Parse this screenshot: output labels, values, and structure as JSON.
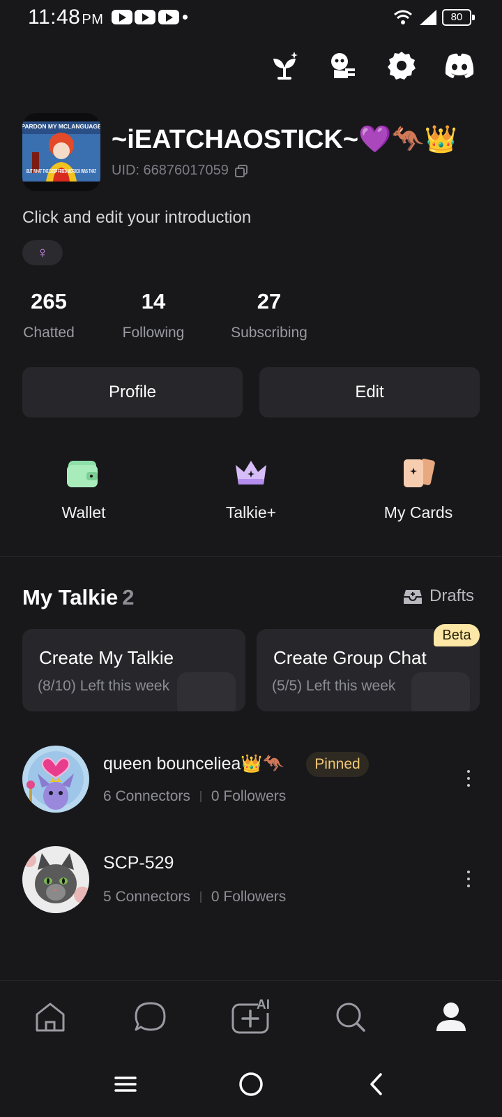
{
  "status_bar": {
    "time": "11:48",
    "ampm": "PM",
    "battery": "80"
  },
  "top_actions": [
    {
      "name": "sprout-icon"
    },
    {
      "name": "character-icon"
    },
    {
      "name": "gear-icon"
    },
    {
      "name": "discord-icon"
    }
  ],
  "profile": {
    "username": "~iEATCHAOSTICK~💜🦘👑",
    "uid": "UID: 66876017059",
    "avatar_caption_top": "PARDON MY MCLANGUAGE",
    "avatar_caption_bottom": "BUT WHAT THE DEEP FRIED MCFUCK WAS THAT",
    "intro": "Click and edit your introduction",
    "gender_symbol": "♀"
  },
  "stats": [
    {
      "value": "265",
      "label": "Chatted"
    },
    {
      "value": "14",
      "label": "Following"
    },
    {
      "value": "27",
      "label": "Subscribing"
    }
  ],
  "buttons": {
    "profile": "Profile",
    "edit": "Edit"
  },
  "quick_links": [
    {
      "label": "Wallet",
      "icon": "wallet-icon"
    },
    {
      "label": "Talkie+",
      "icon": "crown-icon"
    },
    {
      "label": "My Cards",
      "icon": "cards-icon"
    }
  ],
  "my_talkie": {
    "title": "My Talkie",
    "count": "2",
    "drafts_label": "Drafts",
    "create_cards": [
      {
        "title": "Create My Talkie",
        "subtitle": "(8/10) Left this week"
      },
      {
        "title": "Create Group Chat",
        "subtitle": "(5/5) Left this week",
        "badge": "Beta"
      }
    ],
    "items": [
      {
        "name": "queen bounceliea👑🦘",
        "badge": "Pinned",
        "connectors": "6 Connectors",
        "followers": "0 Followers"
      },
      {
        "name": "SCP-529",
        "connectors": "5 Connectors",
        "followers": "0 Followers"
      }
    ]
  },
  "bottom_nav": [
    {
      "name": "home-icon"
    },
    {
      "name": "chat-icon"
    },
    {
      "name": "create-ai-icon",
      "label": "AI"
    },
    {
      "name": "search-icon"
    },
    {
      "name": "profile-icon"
    }
  ],
  "colors": {
    "background": "#18181b",
    "surface": "#27272b",
    "wallet": "#8fe0a8",
    "talkie_plus": "#c9a6f5",
    "cards": "#f6c39d",
    "beta_badge": "#fde7a6",
    "pinned_text": "#f2c877"
  }
}
